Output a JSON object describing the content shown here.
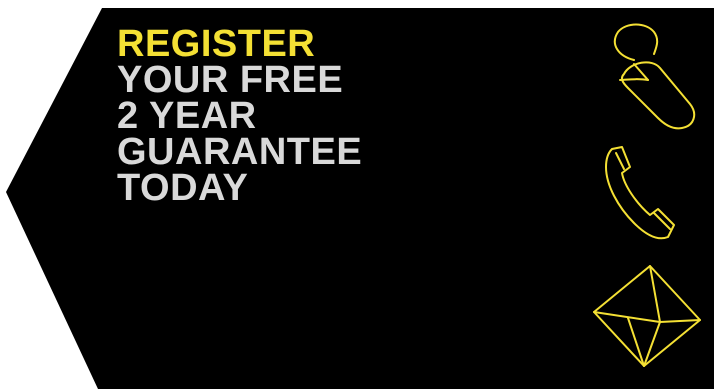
{
  "banner": {
    "headline": {
      "highlight": "REGISTER",
      "lines": [
        "YOUR FREE",
        "2 YEAR",
        "GUARANTEE",
        "TODAY"
      ]
    },
    "icons": [
      "mouse-icon",
      "phone-icon",
      "envelope-icon"
    ]
  },
  "colors": {
    "background": "#000000",
    "accent": "#f4e034",
    "text": "#d9d9d9"
  }
}
